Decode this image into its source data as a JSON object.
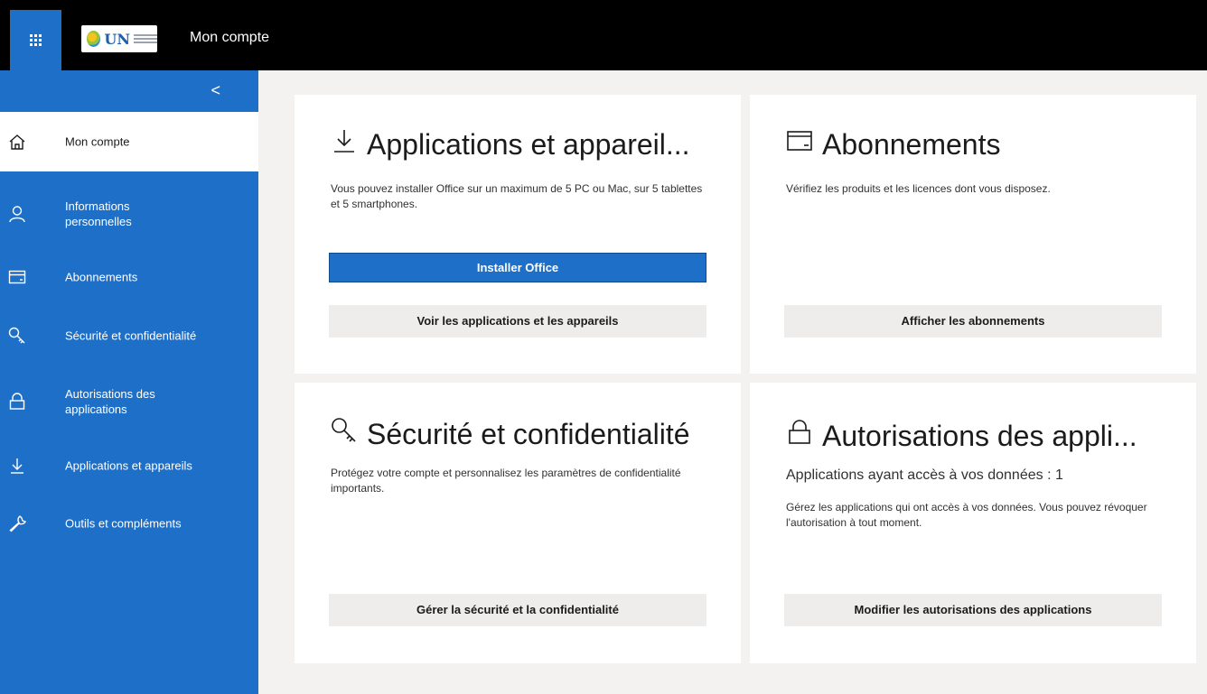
{
  "header": {
    "app_title": "Mon compte",
    "waffle_icon": "waffle-icon",
    "logo_text": "UN",
    "brand_color": "#1e6fc8"
  },
  "sidebar": {
    "collapse_glyph": "<",
    "items": [
      {
        "label": "Mon compte",
        "icon": "home-icon",
        "active": true
      },
      {
        "label": "Informations personnelles",
        "icon": "person-icon",
        "active": false
      },
      {
        "label": "Abonnements",
        "icon": "card-icon",
        "active": false
      },
      {
        "label": "Sécurité et confidentialité",
        "icon": "key-icon",
        "active": false
      },
      {
        "label": "Autorisations des applications",
        "icon": "lock-icon",
        "active": false
      },
      {
        "label": "Applications et appareils",
        "icon": "download-icon",
        "active": false
      },
      {
        "label": "Outils et compléments",
        "icon": "wrench-icon",
        "active": false
      }
    ]
  },
  "cards": {
    "apps": {
      "title": "Applications et appareil...",
      "icon": "download-icon",
      "description": "Vous pouvez installer Office sur un maximum de 5 PC ou Mac, sur 5 tablettes et 5 smartphones.",
      "primary_button": "Installer Office",
      "secondary_button": "Voir les applications et les appareils"
    },
    "subscriptions": {
      "title": "Abonnements",
      "icon": "card-icon",
      "description": "Vérifiez les produits et les licences dont vous disposez.",
      "secondary_button": "Afficher les abonnements"
    },
    "security": {
      "title": "Sécurité et confidentialité",
      "icon": "key-icon",
      "description": "Protégez votre compte et personnalisez les paramètres de confidentialité importants.",
      "secondary_button": "Gérer la sécurité et la confidentialité"
    },
    "permissions": {
      "title": "Autorisations des appli...",
      "icon": "lock-icon",
      "subtitle": "Applications ayant accès à vos données : 1",
      "description": "Gérez les applications qui ont accès à vos données. Vous pouvez révoquer l'autorisation à tout moment.",
      "secondary_button": "Modifier les autorisations des applications"
    }
  }
}
